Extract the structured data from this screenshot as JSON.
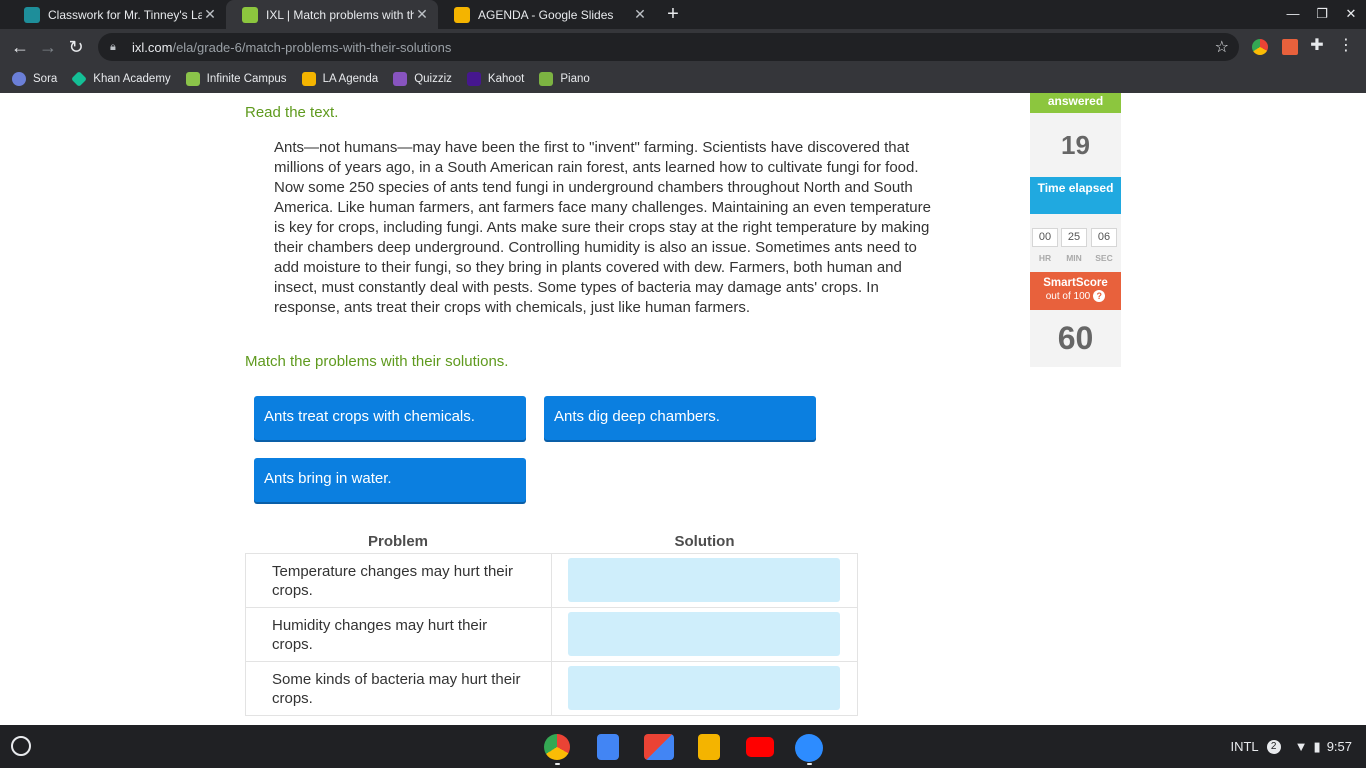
{
  "browser": {
    "tabs": [
      {
        "title": "Classwork for Mr. Tinney's Lang",
        "favicon_color": "#1e8e9a"
      },
      {
        "title": "IXL | Match problems with their s",
        "favicon_color": "#8cc63e"
      },
      {
        "title": "AGENDA - Google Slides",
        "favicon_color": "#f4b400"
      }
    ],
    "new_tab_label": "+",
    "url_host": "ixl.com",
    "url_path": "/ela/grade-6/match-problems-with-their-solutions",
    "bookmarks": [
      {
        "label": "Sora",
        "color": "#6b7fd7"
      },
      {
        "label": "Khan Academy",
        "color": "#14bf96"
      },
      {
        "label": "Infinite Campus",
        "color": "#8bc34a"
      },
      {
        "label": "LA Agenda",
        "color": "#f4b400"
      },
      {
        "label": "Quizziz",
        "color": "#8854c0"
      },
      {
        "label": "Kahoot",
        "color": "#46178f"
      },
      {
        "label": "Piano",
        "color": "#7cb342"
      }
    ]
  },
  "lesson": {
    "read_prompt": "Read the text.",
    "passage": "Ants—not humans—may have been the first to \"invent\" farming. Scientists have discovered that millions of years ago, in a South American rain forest, ants learned how to cultivate fungi for food. Now some 250 species of ants tend fungi in underground chambers throughout North and South America. Like human farmers, ant farmers face many challenges. Maintaining an even temperature is key for crops, including fungi. Ants make sure their crops stay at the right temperature by making their chambers deep underground. Controlling humidity is also an issue. Sometimes ants need to add moisture to their fungi, so they bring in plants covered with dew. Farmers, both human and insect, must constantly deal with pests. Some types of bacteria may damage ants' crops. In response, ants treat their crops with chemicals, just like human farmers.",
    "match_prompt": "Match the problems with their solutions.",
    "tiles": [
      "Ants treat crops with chemicals.",
      "Ants dig deep chambers.",
      "Ants bring in water."
    ],
    "table": {
      "problem_header": "Problem",
      "solution_header": "Solution",
      "rows": [
        "Temperature changes may hurt their crops.",
        "Humidity changes may hurt their crops.",
        "Some kinds of bacteria may hurt their crops."
      ]
    }
  },
  "sidebar": {
    "answered_label": "answered",
    "answered_count": "19",
    "time_label": "Time elapsed",
    "time": {
      "hr": "00",
      "min": "25",
      "sec": "06"
    },
    "time_units": {
      "hr": "HR",
      "min": "MIN",
      "sec": "SEC"
    },
    "smartscore_label": "SmartScore",
    "smartscore_sub": "out of 100",
    "help_glyph": "?",
    "smartscore": "60",
    "colors": {
      "green": "#8cc63e",
      "blue": "#20a9e0",
      "orange": "#e8613c"
    }
  },
  "shelf": {
    "apps": [
      "chrome-icon",
      "docs-icon",
      "gmail-icon",
      "slides-icon",
      "youtube-icon",
      "zoom-icon"
    ],
    "ime": "INTL",
    "notification_count": "2",
    "clock": "9:57"
  }
}
